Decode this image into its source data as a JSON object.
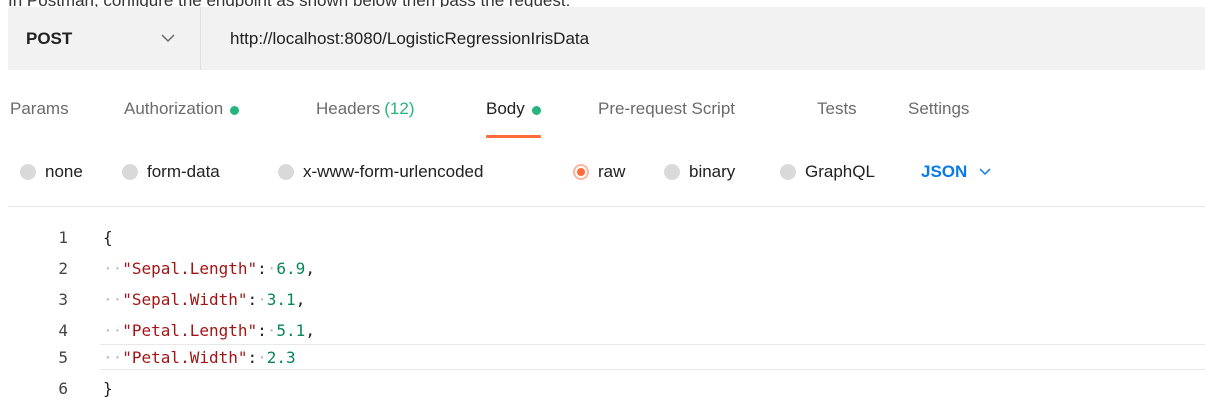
{
  "banner_text": "In Postman, configure the endpoint as shown below then pass the request:",
  "request": {
    "method": "POST",
    "url": "http://localhost:8080/LogisticRegressionIrisData"
  },
  "tabs": [
    {
      "label": "Params",
      "active": false
    },
    {
      "label": "Authorization",
      "active": false,
      "dot": true
    },
    {
      "label": "Headers",
      "count": "(12)",
      "active": false
    },
    {
      "label": "Body",
      "active": true,
      "dot": true
    },
    {
      "label": "Pre-request Script",
      "active": false
    },
    {
      "label": "Tests",
      "active": false
    },
    {
      "label": "Settings",
      "active": false
    }
  ],
  "body_types": [
    {
      "label": "none",
      "selected": false
    },
    {
      "label": "form-data",
      "selected": false
    },
    {
      "label": "x-www-form-urlencoded",
      "selected": false
    },
    {
      "label": "raw",
      "selected": true
    },
    {
      "label": "binary",
      "selected": false
    },
    {
      "label": "GraphQL",
      "selected": false
    }
  ],
  "raw_format": "JSON",
  "editor": {
    "lines": [
      {
        "num": "1",
        "open": "{"
      },
      {
        "num": "2",
        "key": "\"Sepal.Length\"",
        "value": "6.9",
        "comma": ","
      },
      {
        "num": "3",
        "key": "\"Sepal.Width\"",
        "value": "3.1",
        "comma": ","
      },
      {
        "num": "4",
        "key": "\"Petal.Length\"",
        "value": "5.1",
        "comma": ","
      },
      {
        "num": "5",
        "key": "\"Petal.Width\"",
        "value": "2.3",
        "comma": ""
      },
      {
        "num": "6",
        "close": "}"
      }
    ],
    "current_line": 5
  },
  "colors": {
    "accent": "#ff6c37",
    "status_green": "#26b47f",
    "link_blue": "#097bed",
    "json_key": "#a31515",
    "json_number": "#098658"
  }
}
